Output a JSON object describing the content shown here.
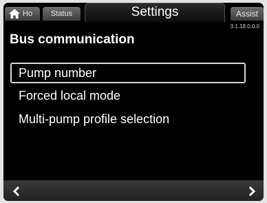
{
  "tabs": {
    "home_label": "Ho",
    "status_label": "Status",
    "settings_label": "Settings",
    "assist_label": "Assist"
  },
  "version": "3.1.18.0.0.0",
  "page_title": "Bus communication",
  "menu": {
    "items": [
      {
        "label": "Pump number",
        "selected": true
      },
      {
        "label": "Forced local mode",
        "selected": false
      },
      {
        "label": "Multi-pump profile selection",
        "selected": false
      }
    ]
  },
  "icons": {
    "home": "home-icon",
    "back": "chevron-left-icon",
    "forward": "chevron-right-icon"
  },
  "colors": {
    "background": "#000000",
    "text": "#ffffff",
    "selection_border": "#d8d8d8"
  }
}
